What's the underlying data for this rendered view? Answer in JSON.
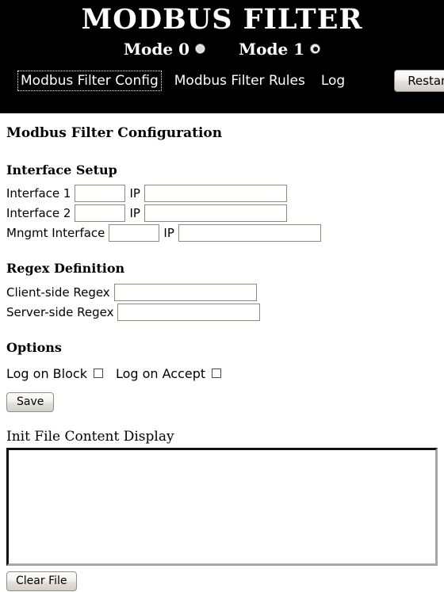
{
  "header": {
    "app_title": "MODBUS FILTER",
    "modes": [
      {
        "label": "Mode 0",
        "selected": false,
        "icon": "radio-unchecked-icon"
      },
      {
        "label": "Mode 1",
        "selected": true,
        "icon": "radio-checked-icon"
      }
    ],
    "nav": [
      {
        "label": "Modbus Filter Config",
        "focused": true
      },
      {
        "label": "Modbus Filter Rules",
        "focused": false
      },
      {
        "label": "Log",
        "focused": false
      }
    ],
    "restart_label": "Restart",
    "background_color": "#000000",
    "text_color": "#ffffff"
  },
  "main": {
    "page_heading": "Modbus Filter Configuration",
    "interface_setup": {
      "heading": "Interface Setup",
      "rows": [
        {
          "label": "Interface 1",
          "name_value": "",
          "name_placeholder": "",
          "ip_label": "IP",
          "ip_value": "",
          "ip_placeholder": ""
        },
        {
          "label": "Interface 2",
          "name_value": "",
          "name_placeholder": "",
          "ip_label": "IP",
          "ip_value": "",
          "ip_placeholder": ""
        },
        {
          "label": "Mngmt Interface",
          "name_value": "",
          "name_placeholder": "",
          "ip_label": "IP",
          "ip_value": "",
          "ip_placeholder": ""
        }
      ]
    },
    "regex_definition": {
      "heading": "Regex Definition",
      "rows": [
        {
          "label": "Client-side Regex",
          "value": "",
          "placeholder": ""
        },
        {
          "label": "Server-side Regex",
          "value": "",
          "placeholder": ""
        }
      ]
    },
    "options": {
      "heading": "Options",
      "checkboxes": [
        {
          "label": "Log on Block",
          "checked": false
        },
        {
          "label": "Log on Accept",
          "checked": false
        }
      ],
      "save_label": "Save"
    },
    "init_file": {
      "heading": "Init File Content Display",
      "content": "",
      "placeholder": "",
      "clear_label": "Clear File"
    }
  }
}
